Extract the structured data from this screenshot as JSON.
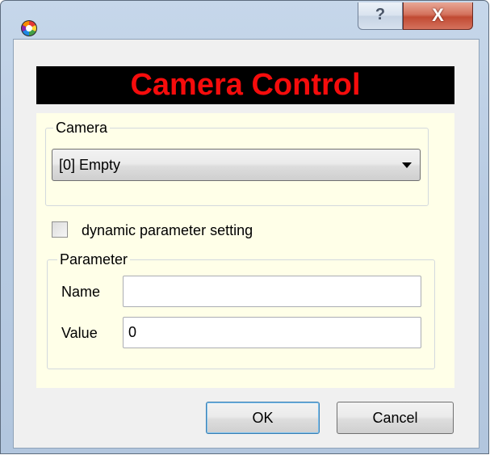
{
  "titlebar": {
    "icon": "app-color-wheel-icon",
    "help_label": "?",
    "close_label": "X"
  },
  "banner": {
    "title": "Camera Control",
    "text_color": "#f50c0c",
    "background": "#000000"
  },
  "camera_group": {
    "title": "Camera",
    "selected": "[0] Empty"
  },
  "dynamic_checkbox": {
    "label": "dynamic parameter setting",
    "checked": false
  },
  "parameter_group": {
    "title": "Parameter",
    "name_label": "Name",
    "name_value": "",
    "value_label": "Value",
    "value_value": "0"
  },
  "buttons": {
    "ok": "OK",
    "cancel": "Cancel"
  },
  "colors": {
    "panel_background": "#ffffe8"
  }
}
